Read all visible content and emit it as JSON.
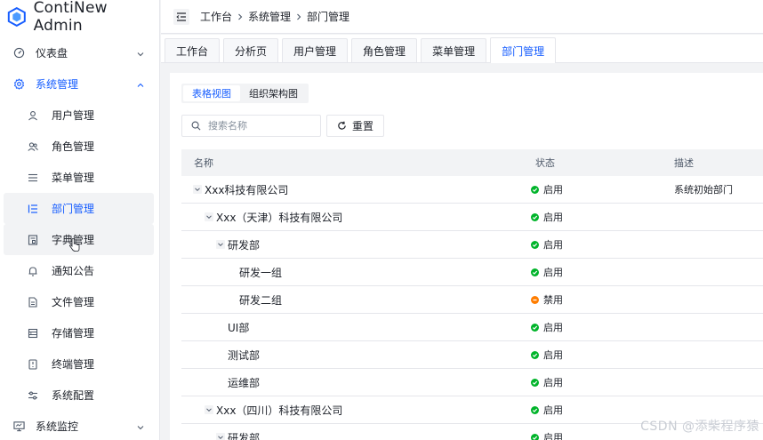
{
  "app": {
    "title": "ContiNew Admin"
  },
  "sidebar": {
    "items": [
      {
        "label": "仪表盘",
        "icon": "dashboard-icon",
        "type": "top",
        "arrow": "down"
      },
      {
        "label": "系统管理",
        "icon": "gear-icon",
        "type": "top-open",
        "arrow": "up"
      },
      {
        "label": "用户管理",
        "icon": "user-icon",
        "type": "sub"
      },
      {
        "label": "角色管理",
        "icon": "users-icon",
        "type": "sub"
      },
      {
        "label": "菜单管理",
        "icon": "menu-icon",
        "type": "sub"
      },
      {
        "label": "部门管理",
        "icon": "tree-list-icon",
        "type": "sub",
        "active": true
      },
      {
        "label": "字典管理",
        "icon": "dictionary-icon",
        "type": "sub",
        "hover": true
      },
      {
        "label": "通知公告",
        "icon": "bell-icon",
        "type": "sub"
      },
      {
        "label": "文件管理",
        "icon": "file-icon",
        "type": "sub"
      },
      {
        "label": "存储管理",
        "icon": "storage-icon",
        "type": "sub"
      },
      {
        "label": "终端管理",
        "icon": "terminal-icon",
        "type": "sub"
      },
      {
        "label": "系统配置",
        "icon": "sliders-icon",
        "type": "sub"
      },
      {
        "label": "系统监控",
        "icon": "monitor-icon",
        "type": "top",
        "arrow": "down"
      }
    ]
  },
  "header": {
    "breadcrumb": [
      "工作台",
      "系统管理",
      "部门管理"
    ]
  },
  "tabs": [
    {
      "label": "工作台"
    },
    {
      "label": "分析页"
    },
    {
      "label": "用户管理"
    },
    {
      "label": "角色管理"
    },
    {
      "label": "菜单管理"
    },
    {
      "label": "部门管理",
      "active": true
    }
  ],
  "view_switch": {
    "table_view": "表格视图",
    "org_view": "组织架构图"
  },
  "search": {
    "placeholder": "搜索名称",
    "value": ""
  },
  "reset_label": "重置",
  "table": {
    "headers": {
      "name": "名称",
      "status": "状态",
      "desc": "描述"
    },
    "rows": [
      {
        "name": "Xxx科技有限公司",
        "level": 0,
        "expandable": true,
        "status": "启用",
        "enabled": true,
        "desc": "系统初始部门"
      },
      {
        "name": "Xxx（天津）科技有限公司",
        "level": 1,
        "expandable": true,
        "status": "启用",
        "enabled": true,
        "desc": ""
      },
      {
        "name": "研发部",
        "level": 2,
        "expandable": true,
        "status": "启用",
        "enabled": true,
        "desc": ""
      },
      {
        "name": "研发一组",
        "level": 3,
        "expandable": false,
        "status": "启用",
        "enabled": true,
        "desc": ""
      },
      {
        "name": "研发二组",
        "level": 3,
        "expandable": false,
        "status": "禁用",
        "enabled": false,
        "desc": ""
      },
      {
        "name": "UI部",
        "level": 2,
        "expandable": false,
        "status": "启用",
        "enabled": true,
        "desc": ""
      },
      {
        "name": "测试部",
        "level": 2,
        "expandable": false,
        "status": "启用",
        "enabled": true,
        "desc": ""
      },
      {
        "name": "运维部",
        "level": 2,
        "expandable": false,
        "status": "启用",
        "enabled": true,
        "desc": ""
      },
      {
        "name": "Xxx（四川）科技有限公司",
        "level": 1,
        "expandable": true,
        "status": "启用",
        "enabled": true,
        "desc": ""
      },
      {
        "name": "研发部",
        "level": 2,
        "expandable": true,
        "status": "启用",
        "enabled": true,
        "desc": ""
      }
    ]
  },
  "watermark": "CSDN @添柴程序猿",
  "colors": {
    "primary": "#165dff",
    "enabled": "#00b42a",
    "disabled": "#ff7d00"
  }
}
